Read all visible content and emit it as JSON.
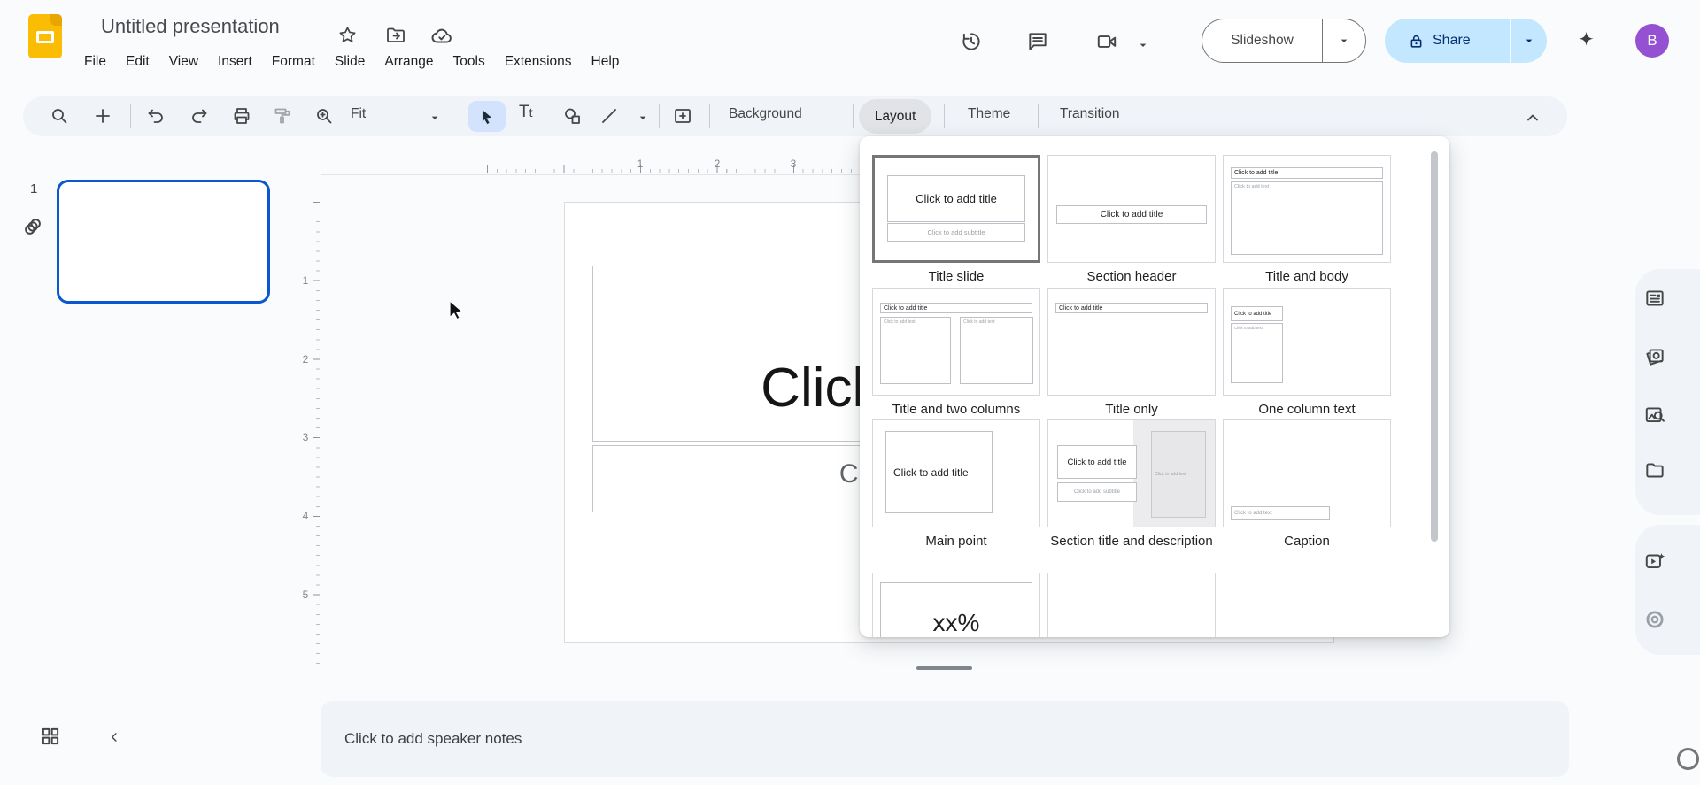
{
  "header": {
    "title": "Untitled presentation",
    "menus": [
      "File",
      "Edit",
      "View",
      "Insert",
      "Format",
      "Slide",
      "Arrange",
      "Tools",
      "Extensions",
      "Help"
    ],
    "slideshow_label": "Slideshow",
    "share_label": "Share",
    "avatar_letter": "B"
  },
  "toolbar": {
    "fit_label": "Fit",
    "background_label": "Background",
    "layout_label": "Layout",
    "theme_label": "Theme",
    "transition_label": "Transition"
  },
  "filmstrip": {
    "slide_number": "1"
  },
  "canvas": {
    "h_ruler": [
      "1",
      "2",
      "3"
    ],
    "v_ruler": [
      "1",
      "2",
      "3",
      "4",
      "5"
    ],
    "title_placeholder": "Click to add title",
    "subtitle_placeholder": "Click to add subtitle"
  },
  "notes": {
    "placeholder": "Click to add speaker notes"
  },
  "layout_panel": {
    "placeholders": {
      "title": "Click to add title",
      "subtitle": "Click to add subtitle",
      "text": "Click to add text"
    },
    "items": [
      {
        "label": "Title slide",
        "selected": true
      },
      {
        "label": "Section header"
      },
      {
        "label": "Title and body"
      },
      {
        "label": "Title and two columns"
      },
      {
        "label": "Title only"
      },
      {
        "label": "One column text"
      },
      {
        "label": "Main point"
      },
      {
        "label": "Section title and description"
      },
      {
        "label": "Caption"
      },
      {
        "big_text": "xx%"
      },
      {}
    ]
  },
  "colors": {
    "accent": "#0b57d0",
    "share_bg": "#c2e7ff",
    "share_text": "#062e6f",
    "tool_selected_bg": "#d3e3fd",
    "avatar_bg": "#9452d2",
    "surface": "#f0f4f9",
    "chrome_bg": "#f9fbfd",
    "slides_yellow": "#fbbc04"
  }
}
